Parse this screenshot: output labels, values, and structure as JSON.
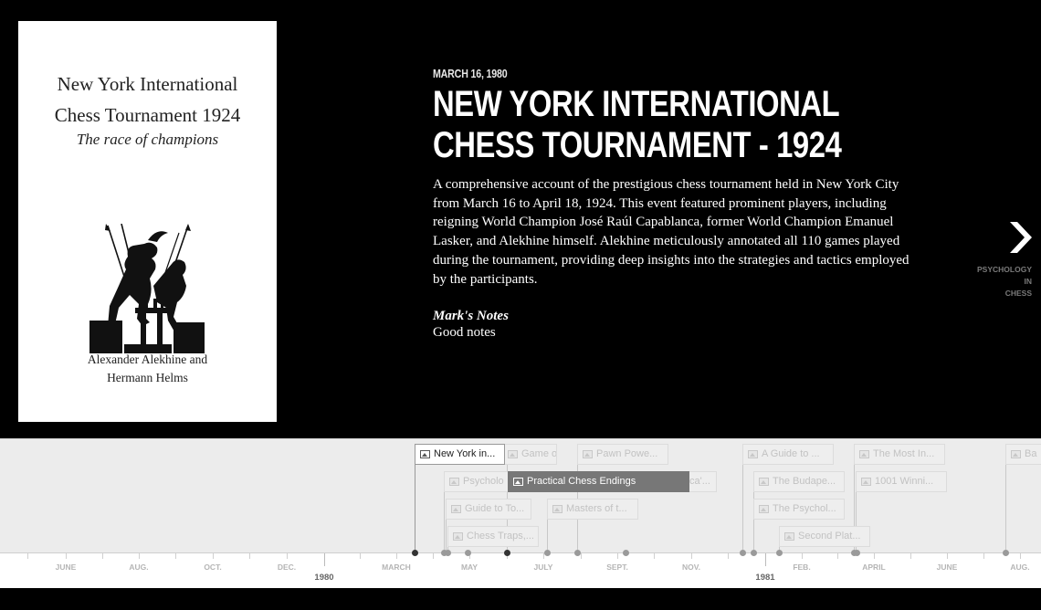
{
  "cover": {
    "title_line1": "New York International",
    "title_line2": "Chess Tournament 1924",
    "subtitle": "The race of champions",
    "authors_line1": "Alexander Alekhine and",
    "authors_line2": "Hermann Helms"
  },
  "slide": {
    "date": "MARCH 16, 1980",
    "headline_line1": "NEW YORK INTERNATIONAL",
    "headline_line2": "CHESS TOURNAMENT - 1924",
    "description": "A comprehensive account of the prestigious chess tournament held in New York City from March 16 to April 18, 1924. This event featured prominent players, including reigning World Champion José Raúl Capablanca, former World Champion Emanuel Lasker, and Alekhine himself. Alekhine meticulously annotated all 110 games played during the tournament, providing deep insights into the strategies and tactics employed by the participants.",
    "notes_label": "Mark's Notes",
    "notes_text": "Good notes"
  },
  "nav_next": {
    "icon": "chevron-right-icon",
    "label_line1": "PSYCHOLOGY IN",
    "label_line2": "CHESS"
  },
  "timeline": {
    "markers": [
      {
        "label": "New York in...",
        "state": "current"
      },
      {
        "label": "Game o...",
        "state": "normal"
      },
      {
        "label": "Pawn Powe...",
        "state": "normal"
      },
      {
        "label": "A Guide to ...",
        "state": "normal"
      },
      {
        "label": "The Most In...",
        "state": "normal"
      },
      {
        "label": "Ba",
        "state": "normal"
      },
      {
        "label": "Psycholo",
        "state": "normal"
      },
      {
        "label": "Practical Chess Endings",
        "state": "active"
      },
      {
        "label": "ca'...",
        "state": "normal"
      },
      {
        "label": "The Budape...",
        "state": "normal"
      },
      {
        "label": "1001 Winni...",
        "state": "normal"
      },
      {
        "label": "Guide to To...",
        "state": "normal"
      },
      {
        "label": "Masters of t...",
        "state": "normal"
      },
      {
        "label": "The Psychol...",
        "state": "normal"
      },
      {
        "label": "Chess Traps,...",
        "state": "normal"
      },
      {
        "label": "Second Plat...",
        "state": "normal"
      }
    ],
    "months": [
      "JUNE",
      "AUG.",
      "OCT.",
      "DEC.",
      "MARCH",
      "MAY",
      "JULY",
      "SEPT.",
      "NOV.",
      "FEB.",
      "APRIL",
      "JUNE",
      "AUG."
    ],
    "years": [
      "1980",
      "1981"
    ]
  }
}
